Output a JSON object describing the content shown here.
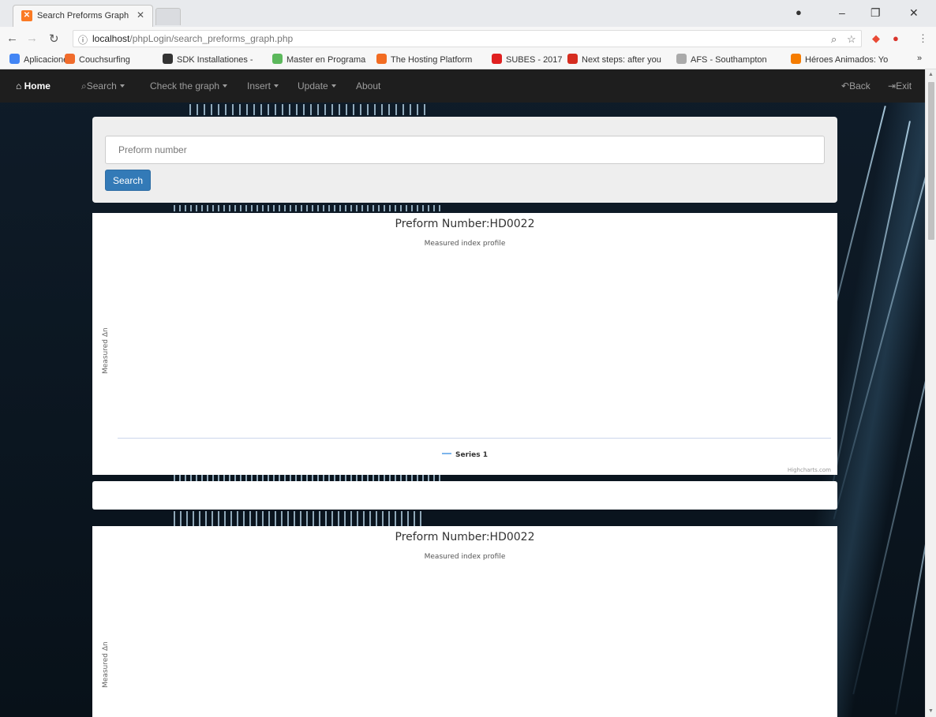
{
  "browser": {
    "tab_title": "Search Preforms Graph F",
    "tab_favicon": "xampp-icon",
    "url_host": "localhost",
    "url_path": "/phpLogin/search_preforms_graph.php",
    "bookmarks": [
      {
        "label": "Aplicaciones",
        "color": "#4285f4"
      },
      {
        "label": "Couchsurfing",
        "color": "#f06c2c"
      },
      {
        "label": "SDK Installationes -",
        "color": "#333333"
      },
      {
        "label": "Master en Programa",
        "color": "#5cb85c"
      },
      {
        "label": "The Hosting Platform",
        "color": "#f26c22"
      },
      {
        "label": "SUBES - 2017",
        "color": "#e02020"
      },
      {
        "label": "Next steps: after you",
        "color": "#d62d20"
      },
      {
        "label": "AFS - Southampton",
        "color": "#aaaaaa"
      },
      {
        "label": "Héroes Animados: Yo",
        "color": "#f57c00"
      }
    ],
    "more": "»"
  },
  "navbar": {
    "home": "Home",
    "search": "Search",
    "graph": "Check the graph",
    "insert": "Insert",
    "update": "Update",
    "about": "About",
    "back": "Back",
    "exit": "Exit"
  },
  "search": {
    "placeholder": "Preform number",
    "button": "Search"
  },
  "charts": [
    {
      "title": "Preform Number:HD0022",
      "subtitle": "Measured index profile",
      "ylabel": "Measured Δn",
      "legend": "Series 1",
      "credits": "Highcharts.com"
    },
    {
      "title": "Preform Number:HD0022",
      "subtitle": "Measured index profile",
      "ylabel": "Measured Δn"
    }
  ],
  "chart_data": [
    {
      "type": "line",
      "title": "Preform Number:HD0022",
      "subtitle": "Measured index profile",
      "ylabel": "Measured Δn",
      "series": [
        {
          "name": "Series 1",
          "values": []
        }
      ]
    },
    {
      "type": "line",
      "title": "Preform Number:HD0022",
      "subtitle": "Measured index profile",
      "ylabel": "Measured Δn",
      "series": []
    }
  ]
}
